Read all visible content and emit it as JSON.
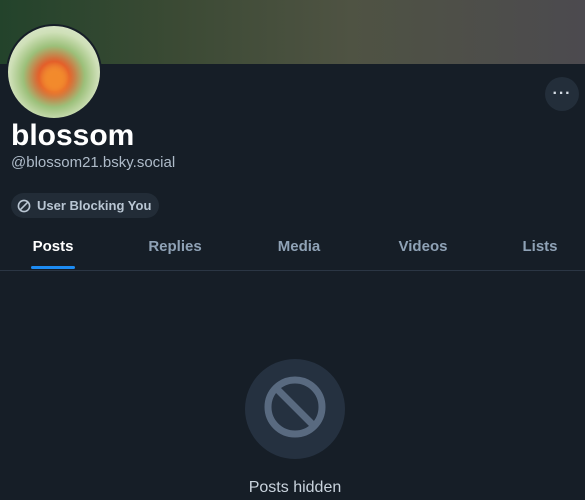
{
  "profile": {
    "display_name": "blossom",
    "handle": "@blossom21.bsky.social"
  },
  "badge": {
    "label": "User Blocking You",
    "icon": "block-icon"
  },
  "more_button": {
    "label": "···",
    "icon": "more-options-icon"
  },
  "tabs": [
    {
      "label": "Posts",
      "active": true
    },
    {
      "label": "Replies",
      "active": false
    },
    {
      "label": "Media",
      "active": false
    },
    {
      "label": "Videos",
      "active": false
    },
    {
      "label": "Lists",
      "active": false
    }
  ],
  "empty_state": {
    "icon": "block-icon",
    "message": "Posts hidden"
  },
  "colors": {
    "accent": "#1d8cf3",
    "background": "#161e27"
  }
}
